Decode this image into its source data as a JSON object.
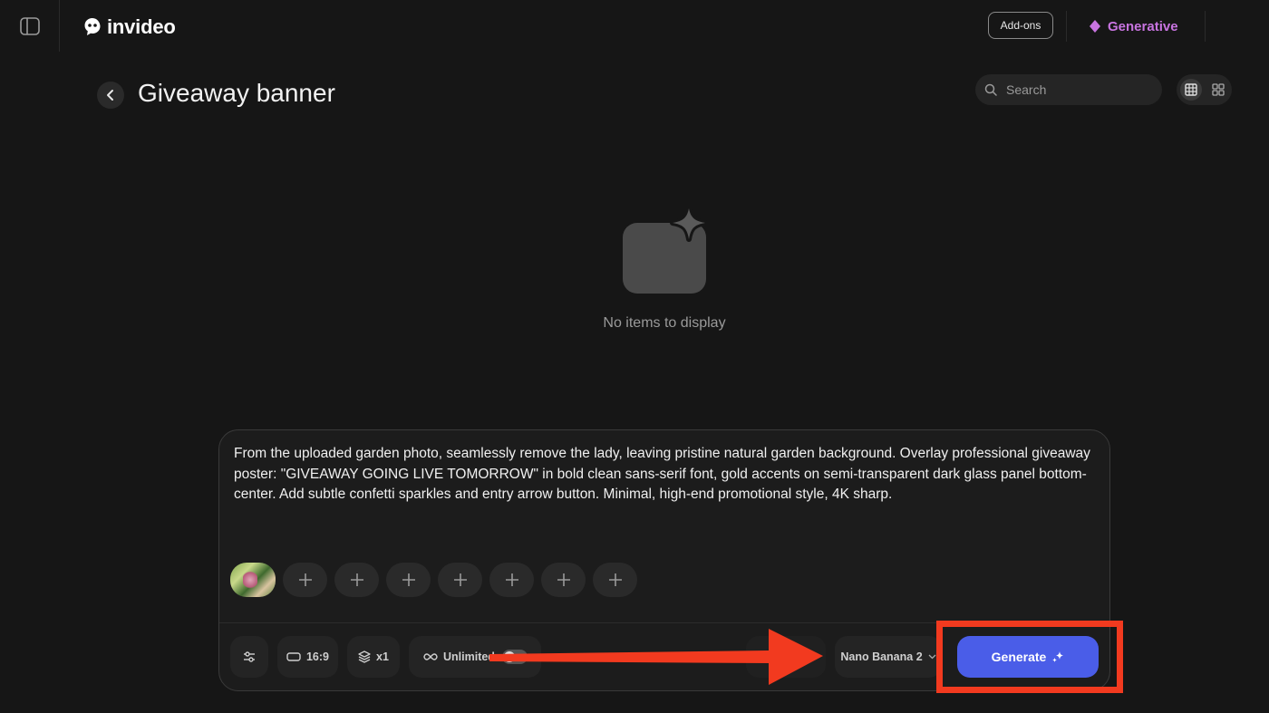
{
  "topbar": {
    "logo_text": "invideo",
    "addons_label": "Add-ons",
    "generative_label": "Generative"
  },
  "header": {
    "title": "Giveaway banner",
    "search_placeholder": "Search"
  },
  "empty_state": {
    "text": "No items to display"
  },
  "composer": {
    "prompt": "From the uploaded garden photo, seamlessly remove the lady, leaving pristine natural garden background. Overlay professional giveaway poster: \"GIVEAWAY GOING LIVE TOMORROW\" in bold clean sans-serif font, gold accents on semi-transparent dark glass panel bottom-center. Add subtle confetti sparkles and entry arrow button. Minimal, high-end promotional style, 4K sharp.",
    "empty_slots": 7,
    "controls": {
      "aspect_ratio": "16:9",
      "count": "x1",
      "unlimited_label": "Unlimited",
      "model": "Nano Banana 2",
      "generate_label": "Generate"
    }
  },
  "colors": {
    "background": "#161616",
    "accent_generative": "#c874e0",
    "generate_button": "#4a5de8",
    "annotation": "#f23a1f"
  },
  "icons": [
    "sidebar-toggle-icon",
    "logo-ghost-icon",
    "diamond-icon",
    "chevron-left-icon",
    "search-icon",
    "grid-large-icon",
    "grid-small-icon",
    "image-sparkle-icon",
    "plus-icon",
    "sliders-icon",
    "aspect-ratio-icon",
    "layers-icon",
    "infinity-icon",
    "chevron-down-icon",
    "sparkle-icon"
  ]
}
